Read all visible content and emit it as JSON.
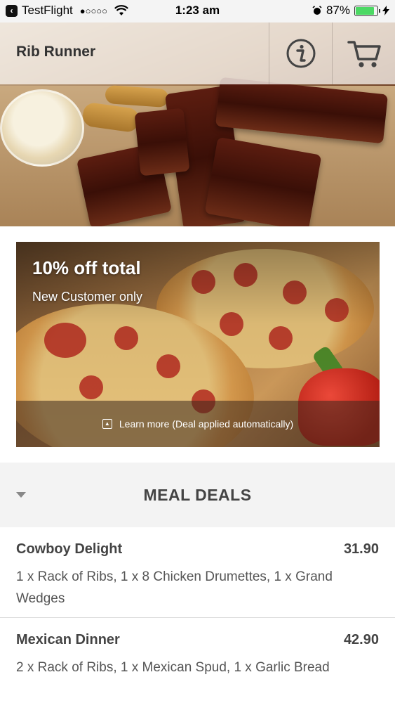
{
  "status_bar": {
    "back_app": "TestFlight",
    "signal": "●○○○○",
    "time": "1:23 am",
    "battery_pct": "87%",
    "battery_level": 0.87
  },
  "header": {
    "title": "Rib Runner",
    "info_icon": "info-icon",
    "cart_icon": "cart-icon"
  },
  "promo": {
    "title": "10% off total",
    "subtitle": "New Customer only",
    "learn_more": "Learn more (Deal applied automatically)"
  },
  "section": {
    "title": "MEAL DEALS",
    "caret_icon": "chevron-down-icon"
  },
  "items": [
    {
      "name": "Cowboy Delight",
      "price": "31.90",
      "description": "1 x Rack of Ribs, 1 x 8 Chicken Drumettes, 1 x Grand Wedges"
    },
    {
      "name": "Mexican Dinner",
      "price": "42.90",
      "description": "2 x Rack of Ribs, 1 x Mexican Spud, 1 x Garlic Bread"
    }
  ]
}
